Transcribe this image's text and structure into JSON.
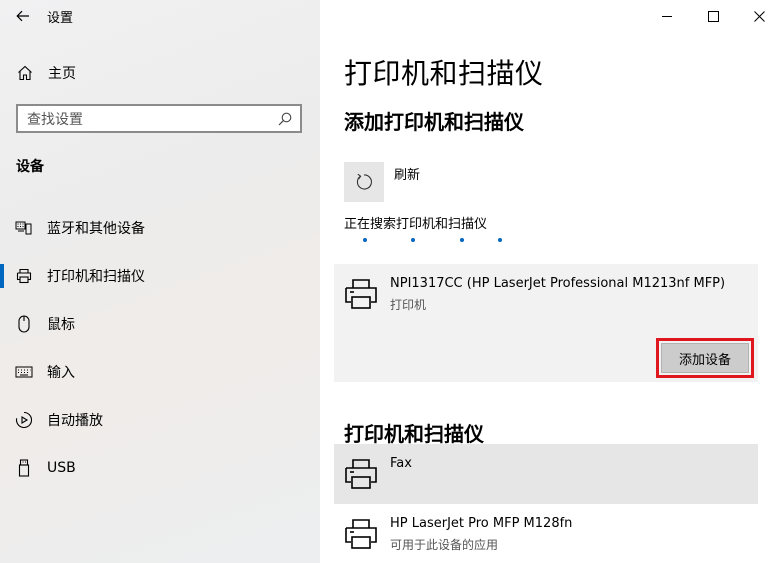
{
  "window": {
    "title": "设置",
    "controls": {
      "minimize": "minimize-icon",
      "maximize": "maximize-icon",
      "close": "close-icon"
    }
  },
  "sidebar": {
    "home_label": "主页",
    "search": {
      "placeholder": "查找设置"
    },
    "section_title": "设备",
    "items": [
      {
        "label": "蓝牙和其他设备",
        "icon": "bluetooth-devices-icon",
        "active": false
      },
      {
        "label": "打印机和扫描仪",
        "icon": "printer-icon",
        "active": true
      },
      {
        "label": "鼠标",
        "icon": "mouse-icon",
        "active": false
      },
      {
        "label": "输入",
        "icon": "keyboard-icon",
        "active": false
      },
      {
        "label": "自动播放",
        "icon": "autoplay-icon",
        "active": false
      },
      {
        "label": "USB",
        "icon": "usb-icon",
        "active": false
      }
    ]
  },
  "main": {
    "title": "打印机和扫描仪",
    "add_section": {
      "heading": "添加打印机和扫描仪",
      "refresh_label": "刷新",
      "searching_label": "正在搜索打印机和扫描仪",
      "found_device": {
        "name": "NPI1317CC (HP LaserJet Professional M1213nf MFP)",
        "type": "打印机",
        "add_button": "添加设备"
      }
    },
    "printers_section": {
      "heading": "打印机和扫描仪",
      "items": [
        {
          "name": "Fax",
          "status": "",
          "selected": true
        },
        {
          "name": "HP LaserJet Pro MFP M128fn",
          "status": "可用于此设备的应用",
          "selected": false
        }
      ]
    }
  },
  "colors": {
    "accent": "#0067c0",
    "highlight_border": "#e0161e"
  }
}
